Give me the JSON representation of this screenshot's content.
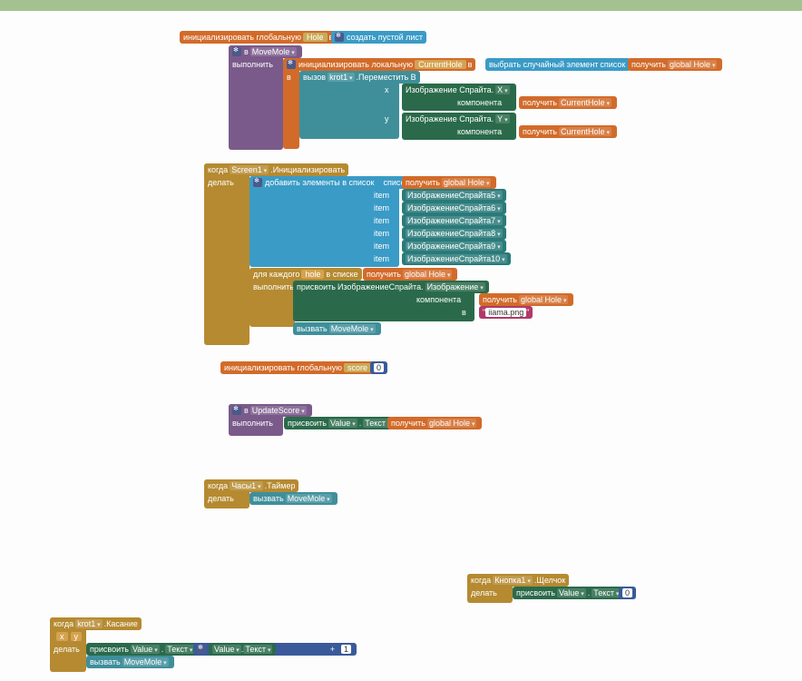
{
  "init_global": "инициализировать глобальную",
  "var_hole": "Hole",
  "to_word": "в",
  "create_empty_list": "создать пустой лист",
  "do_word": "выполнить",
  "move_mole": "MoveMole",
  "init_local": "инициализировать локальную",
  "current_hole": "CurrentHole",
  "pick_random": "выбрать случайный элемент",
  "list_word": "список",
  "get_word": "получить",
  "global_hole": "global Hole",
  "call_word": "вызов",
  "krot1": "krot1",
  "move_to": ".Переместить В",
  "x_label": "x",
  "y_label": "y",
  "sprite_image_dot": "Изображение Спрайта.",
  "X_coord": "X",
  "Y_coord": "Y",
  "component_word": "компонента",
  "when_word": "когда",
  "screen1": "Screen1",
  "on_init": ".Инициализировать",
  "do2": "делать",
  "add_items": "добавить элементы в список",
  "item_word": "item",
  "sprite5": "ИзображениеСпрайта5",
  "sprite6": "ИзображениеСпрайта6",
  "sprite7": "ИзображениеСпрайта7",
  "sprite8": "ИзображениеСпрайта8",
  "sprite9": "ИзображениеСпрайта9",
  "sprite10": "ИзображениеСпрайта10",
  "for_each": "для каждого",
  "hole_var": "hole",
  "in_list": "в списке",
  "set_word": "присвоить",
  "sprite_image_dot2": "ИзображениеСпрайта.",
  "image_prop": "Изображение",
  "string_iiama": "iiama.png",
  "call2": "вызвать",
  "var_score": "score",
  "zero": "0",
  "update_score": "UpdateScore",
  "value_word": "Value",
  "text_word": "Текст",
  "clock1": "Часы1",
  "timer": ".Таймер",
  "button1": "Кнопка1",
  "click": ".Щелчок",
  "touched": ".Касание",
  "plus": "+",
  "one": "1"
}
